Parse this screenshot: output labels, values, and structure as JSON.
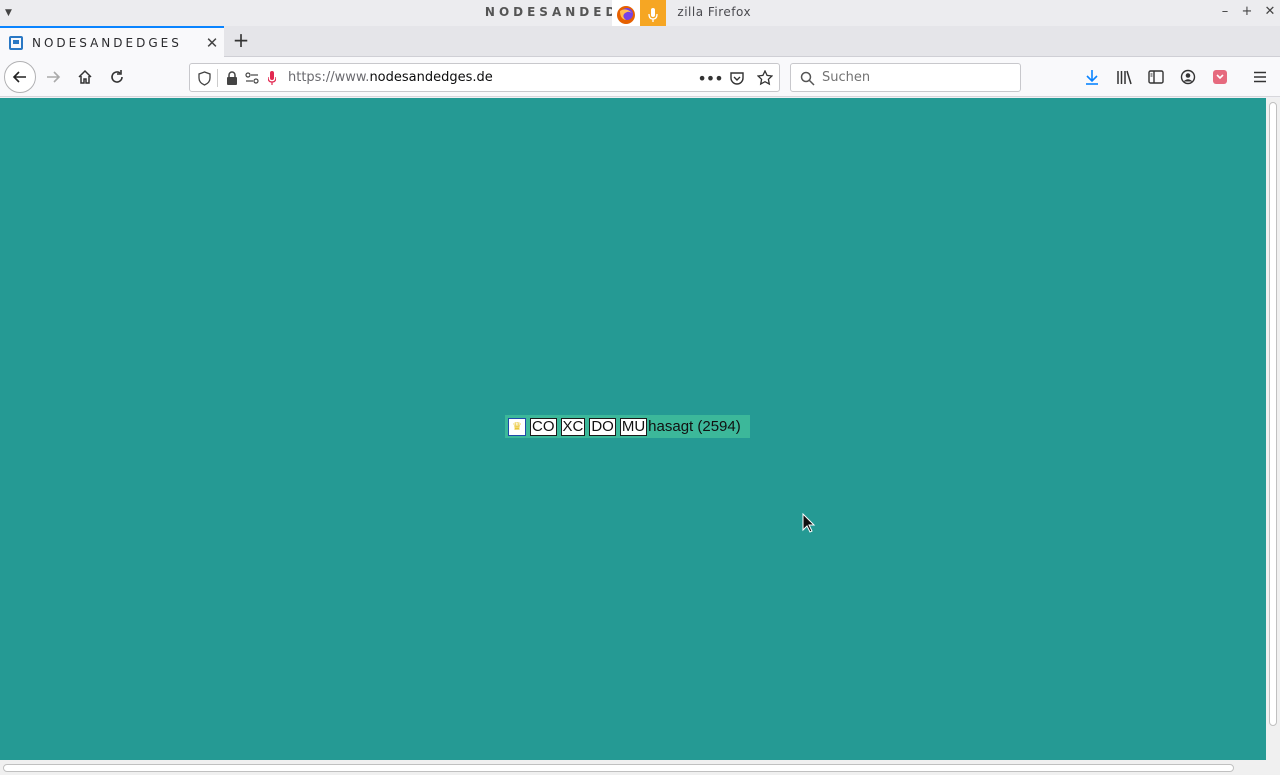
{
  "window": {
    "title_spaced": "NODESANDED",
    "title_rest": "zilla Firefox"
  },
  "tab": {
    "title": "NODESANDEDGES"
  },
  "navbar": {
    "url_prefix": "https://www.",
    "url_host": "nodesandedges.de",
    "search_placeholder": "Suchen"
  },
  "page": {
    "background_color": "#259a94",
    "player": {
      "crown_icon": "crown-icon",
      "badges": [
        "CO",
        "XC",
        "DO",
        "MU"
      ],
      "name_score": "hasagt (2594)"
    }
  }
}
